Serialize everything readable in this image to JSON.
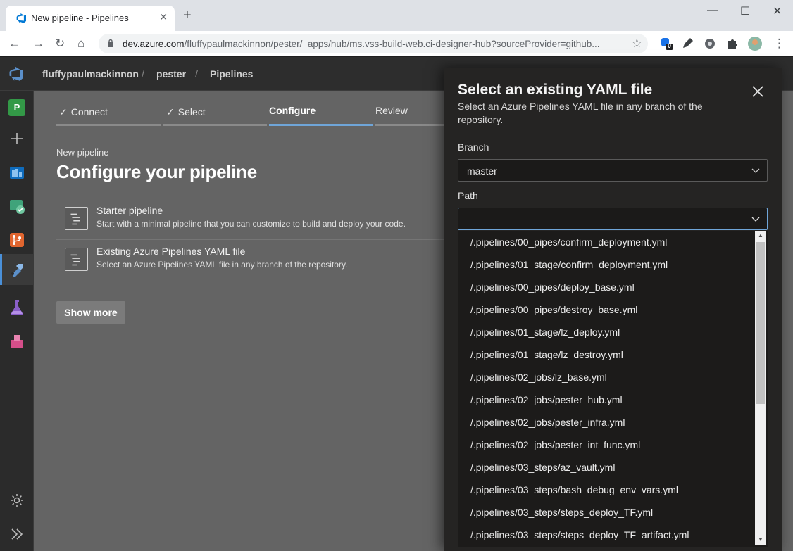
{
  "browser": {
    "tab_title": "New pipeline - Pipelines",
    "url_host": "dev.azure.com",
    "url_path": "/fluffypaulmackinnon/pester/_apps/hub/ms.vss-build-web.ci-designer-hub?sourceProvider=github...",
    "extension_badge": "0"
  },
  "header": {
    "breadcrumbs": [
      "fluffypaulmackinnon",
      "pester",
      "Pipelines"
    ],
    "separator": "/"
  },
  "rail": {
    "project_initial": "P"
  },
  "wizard": {
    "steps": [
      {
        "label": "Connect",
        "done": true
      },
      {
        "label": "Select",
        "done": true
      },
      {
        "label": "Configure",
        "active": true
      },
      {
        "label": "Review"
      }
    ],
    "check_glyph": "✓"
  },
  "main": {
    "kicker": "New pipeline",
    "title": "Configure your pipeline",
    "options": [
      {
        "title": "Starter pipeline",
        "description": "Start with a minimal pipeline that you can customize to build and deploy your code."
      },
      {
        "title": "Existing Azure Pipelines YAML file",
        "description": "Select an Azure Pipelines YAML file in any branch of the repository."
      }
    ],
    "show_more": "Show more"
  },
  "panel": {
    "title": "Select an existing YAML file",
    "subtitle": "Select an Azure Pipelines YAML file in any branch of the repository.",
    "branch_label": "Branch",
    "branch_value": "master",
    "path_label": "Path",
    "path_value": "",
    "path_options": [
      "/.pipelines/00_pipes/confirm_deployment.yml",
      "/.pipelines/01_stage/confirm_deployment.yml",
      "/.pipelines/00_pipes/deploy_base.yml",
      "/.pipelines/00_pipes/destroy_base.yml",
      "/.pipelines/01_stage/lz_deploy.yml",
      "/.pipelines/01_stage/lz_destroy.yml",
      "/.pipelines/02_jobs/lz_base.yml",
      "/.pipelines/02_jobs/pester_hub.yml",
      "/.pipelines/02_jobs/pester_infra.yml",
      "/.pipelines/02_jobs/pester_int_func.yml",
      "/.pipelines/03_steps/az_vault.yml",
      "/.pipelines/03_steps/bash_debug_env_vars.yml",
      "/.pipelines/03_steps/steps_deploy_TF.yml",
      "/.pipelines/03_steps/steps_deploy_TF_artifact.yml"
    ],
    "scroll_position": 0.0
  },
  "colors": {
    "accent": "#6fa5d8",
    "project_badge": "#339947",
    "panel_bg": "#252423"
  }
}
